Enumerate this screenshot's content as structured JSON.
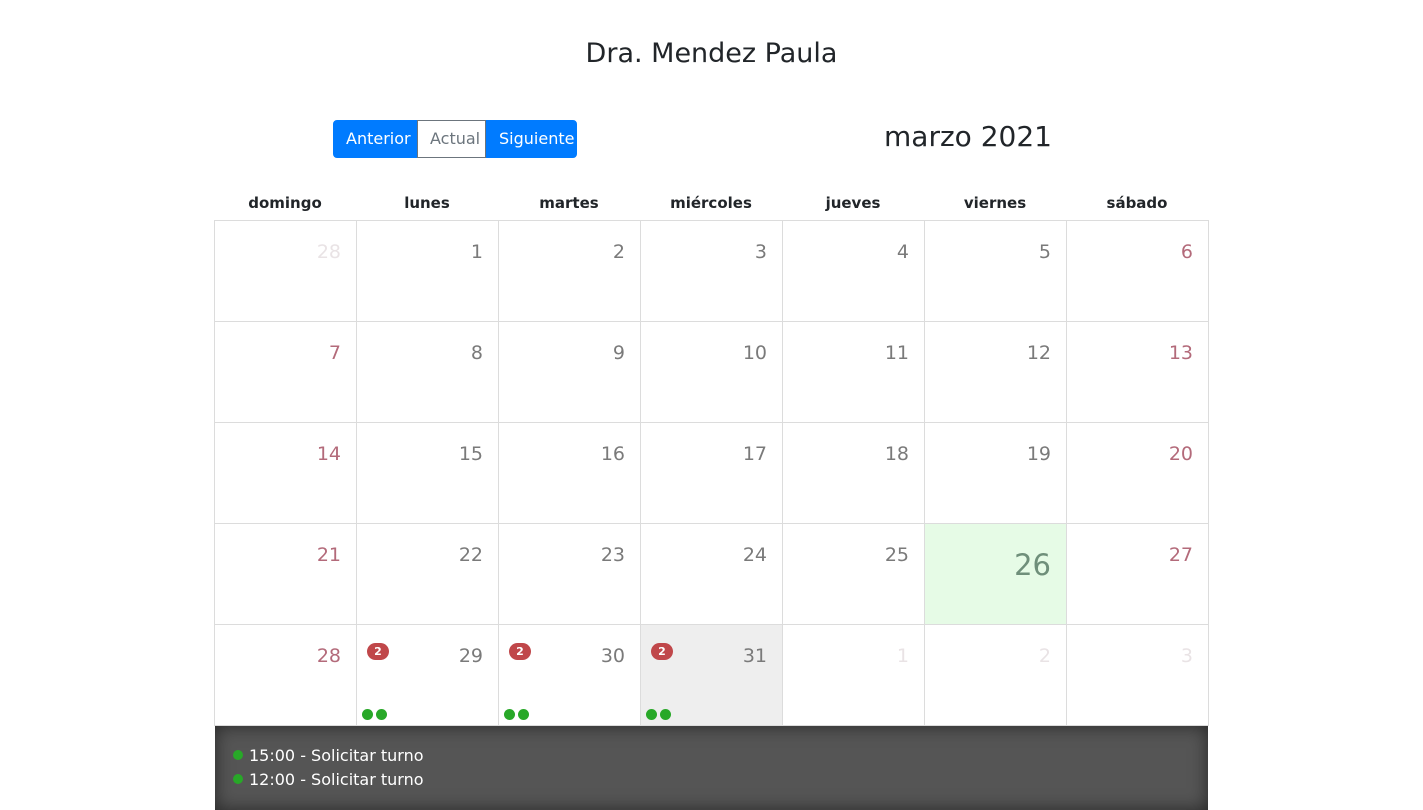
{
  "header": {
    "doctor_name": "Dra. Mendez Paula"
  },
  "nav": {
    "prev_label": "Anterior",
    "today_label": "Actual",
    "next_label": "Siguiente"
  },
  "month_label": "marzo 2021",
  "weekdays": [
    "domingo",
    "lunes",
    "martes",
    "miércoles",
    "jueves",
    "viernes",
    "sábado"
  ],
  "weeks": [
    [
      {
        "day": "28",
        "state": "other"
      },
      {
        "day": "1"
      },
      {
        "day": "2"
      },
      {
        "day": "3"
      },
      {
        "day": "4"
      },
      {
        "day": "5"
      },
      {
        "day": "6",
        "state": "weekend"
      }
    ],
    [
      {
        "day": "7",
        "state": "weekend"
      },
      {
        "day": "8"
      },
      {
        "day": "9"
      },
      {
        "day": "10"
      },
      {
        "day": "11"
      },
      {
        "day": "12"
      },
      {
        "day": "13",
        "state": "weekend"
      }
    ],
    [
      {
        "day": "14",
        "state": "weekend"
      },
      {
        "day": "15"
      },
      {
        "day": "16"
      },
      {
        "day": "17"
      },
      {
        "day": "18"
      },
      {
        "day": "19"
      },
      {
        "day": "20",
        "state": "weekend"
      }
    ],
    [
      {
        "day": "21",
        "state": "weekend"
      },
      {
        "day": "22"
      },
      {
        "day": "23"
      },
      {
        "day": "24"
      },
      {
        "day": "25"
      },
      {
        "day": "26",
        "state": "today"
      },
      {
        "day": "27",
        "state": "weekend"
      }
    ],
    [
      {
        "day": "28",
        "state": "weekend"
      },
      {
        "day": "29",
        "badge": "2",
        "dots": 2
      },
      {
        "day": "30",
        "badge": "2",
        "dots": 2
      },
      {
        "day": "31",
        "badge": "2",
        "dots": 2,
        "state": "selected"
      },
      {
        "day": "1",
        "state": "other"
      },
      {
        "day": "2",
        "state": "other"
      },
      {
        "day": "3",
        "state": "other"
      }
    ]
  ],
  "events": [
    {
      "label": "15:00 - Solicitar turno"
    },
    {
      "label": "12:00 - Solicitar turno"
    }
  ],
  "colors": {
    "primary": "#007bff",
    "today_bg": "#e6fbe6",
    "selected_bg": "#eeeeee",
    "badge": "#c0474a",
    "dot": "#28a828",
    "weekend_text": "#b36a7a",
    "panel_bg": "#555555"
  }
}
